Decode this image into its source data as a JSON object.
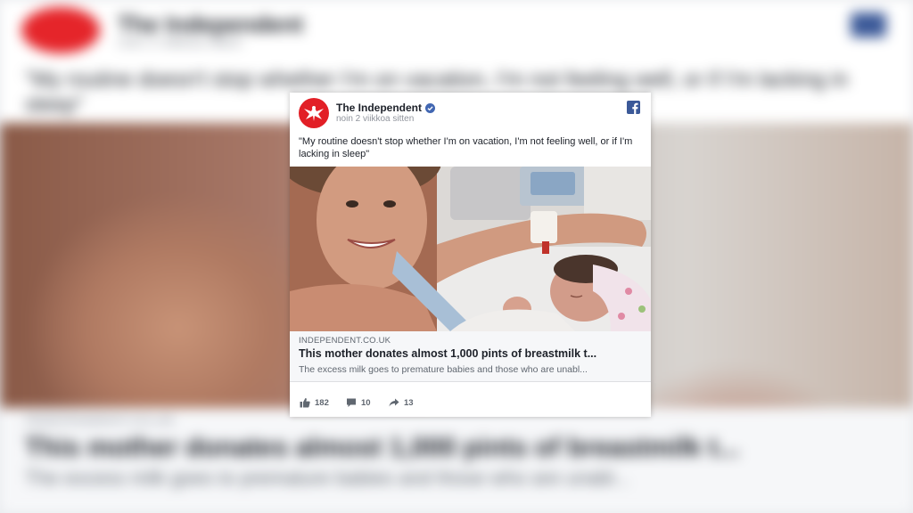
{
  "post": {
    "page_name": "The Independent",
    "timestamp": "noin 2 viikkoa sitten",
    "text": "\"My routine doesn't stop whether I'm on vacation, I'm not feeling well, or if I'm lacking in sleep\"",
    "link": {
      "domain": "INDEPENDENT.CO.UK",
      "title": "This mother donates almost 1,000 pints of breastmilk t...",
      "description": "The excess milk goes to premature babies and those who are unabl..."
    },
    "reactions": {
      "likes": "182",
      "comments": "10",
      "shares": "13"
    }
  },
  "background": {
    "title": "The Independent",
    "timestamp": "noin 2 viikkoa sitten",
    "quote": "\"My routine doesn't stop whether I'm on vacation, I'm not feeling well, or if I'm lacking in sleep\"",
    "domain": "INDEPENDENT.CO.UK",
    "headline": "This mother donates almost 1,000 pints of breastmilk t...",
    "description": "The excess milk goes to premature babies and those who are unabl..."
  },
  "icons": {
    "page_logo": "eagle-logo-icon",
    "verified": "verified-check-icon",
    "facebook": "facebook-icon",
    "like": "thumbs-up-icon",
    "comment": "comment-icon",
    "share": "share-arrow-icon"
  },
  "colors": {
    "brand_red": "#e21f26",
    "facebook_blue": "#3b5998",
    "verified_blue": "#4267b2"
  }
}
